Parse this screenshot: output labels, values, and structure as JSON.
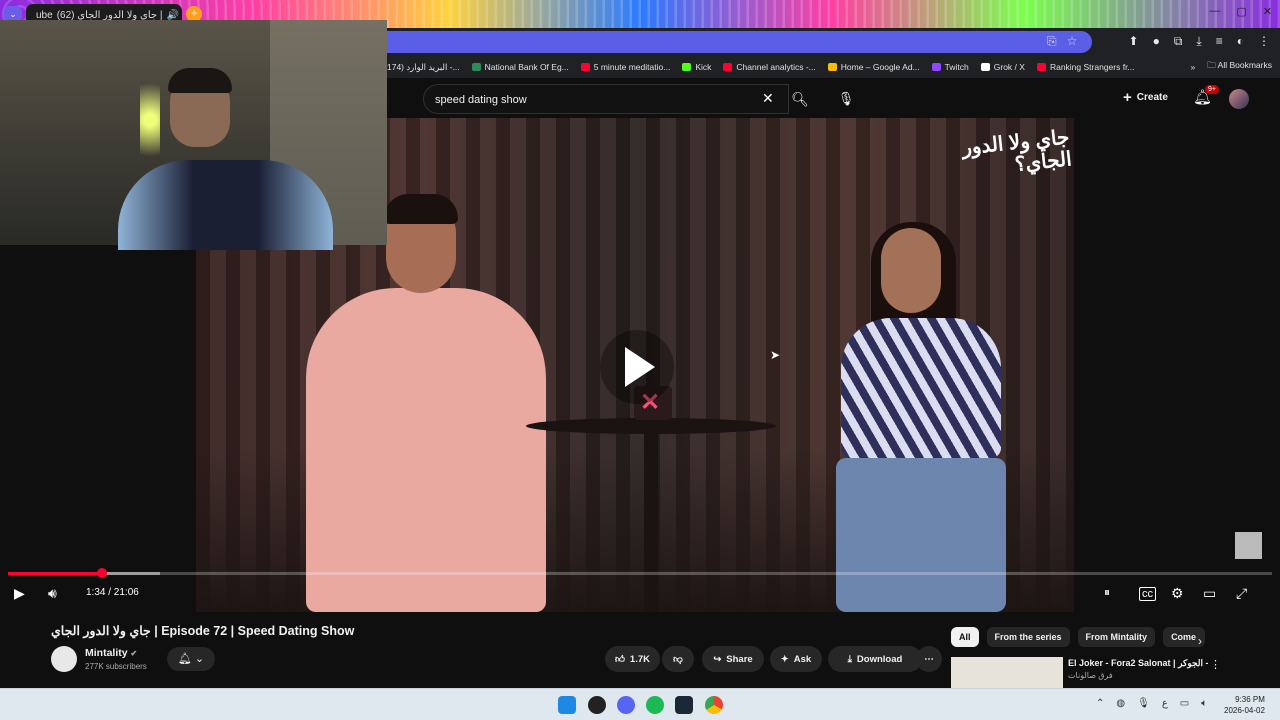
{
  "browser": {
    "tab_title": "(62) جاي ولا الدور الجاي |",
    "tab_prefix": "ube",
    "close_tab": "✕",
    "new_tab": "+",
    "tab_search": "⌄"
  },
  "bookmarks": {
    "items": [
      {
        "label": "174) البريد الوارد -...",
        "color": "#888888"
      },
      {
        "label": "National Bank Of Eg...",
        "color": "#2e8b57"
      },
      {
        "label": "5 minute meditatio...",
        "color": "#ff0033"
      },
      {
        "label": "Kick",
        "color": "#53fc18"
      },
      {
        "label": "Channel analytics -...",
        "color": "#ff0033"
      },
      {
        "label": "Home – Google Ad...",
        "color": "#fbbc04"
      },
      {
        "label": "Twitch",
        "color": "#9146ff"
      },
      {
        "label": "Grok / X",
        "color": "#ffffff"
      },
      {
        "label": "Ranking Strangers fr...",
        "color": "#ff0033"
      }
    ],
    "overflow": "»",
    "all_bookmarks": "All Bookmarks"
  },
  "youtube_header": {
    "search_value": "speed  dating show",
    "create_label": "Create",
    "notifications_badge": "9+"
  },
  "video": {
    "overlay_logo_text": "جاي ولا الدور الجاي؟",
    "time_display": "1:34 / 21:06",
    "progress_fraction": 0.074,
    "title": "جاي ولا الدور الجاي | Episode 72 | Speed Dating Show"
  },
  "channel": {
    "name": "Mintality",
    "verified": "✔",
    "subscribers": "277K subscribers"
  },
  "actions": {
    "likes": "1.7K",
    "share": "Share",
    "ask": "Ask",
    "download": "Download",
    "more": "⋯"
  },
  "related": {
    "chips": [
      "All",
      "From the series",
      "From Mintality",
      "Come"
    ],
    "first_title": "El Joker - Fora2 Salonat | الجوكر -",
    "first_channel": "فرق صالونات"
  },
  "taskbar": {
    "time": "9:36 PM",
    "date": "2026-04-02",
    "lang": "ع"
  },
  "colors": {
    "accent_red": "#ff0033",
    "omnibox": "#5b5fe8",
    "background": "#0f0f0f"
  }
}
